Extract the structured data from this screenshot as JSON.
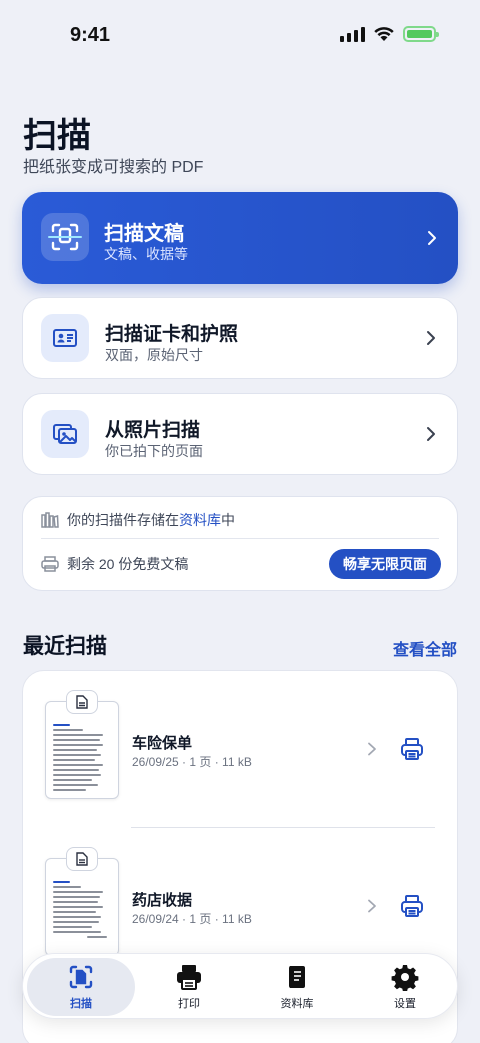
{
  "status": {
    "time": "9:41"
  },
  "header": {
    "title": "扫描",
    "subtitle": "把纸张变成可搜索的 PDF"
  },
  "actions": [
    {
      "title": "扫描文稿",
      "subtitle": "文稿、收据等"
    },
    {
      "title": "扫描证卡和护照",
      "subtitle": "双面，原始尺寸"
    },
    {
      "title": "从照片扫描",
      "subtitle": "你已拍下的页面"
    }
  ],
  "info": {
    "storage_prefix": "你的扫描件存储在",
    "storage_link": "资料库",
    "storage_suffix": "中",
    "remaining": "剩余 20 份免费文稿",
    "upgrade_label": "畅享无限页面"
  },
  "recent": {
    "title": "最近扫描",
    "view_all": "查看全部",
    "items": [
      {
        "name": "车险保单",
        "meta": "26/09/25 · 1 页 · 11 kB"
      },
      {
        "name": "药店收据",
        "meta": "26/09/24 · 1 页 · 11 kB"
      }
    ]
  },
  "tabbar": [
    {
      "label": "扫描"
    },
    {
      "label": "打印"
    },
    {
      "label": "资料库"
    },
    {
      "label": "设置"
    }
  ],
  "colors": {
    "accent": "#2450c4",
    "background": "#eef0f7",
    "battery": "#52c95e"
  }
}
